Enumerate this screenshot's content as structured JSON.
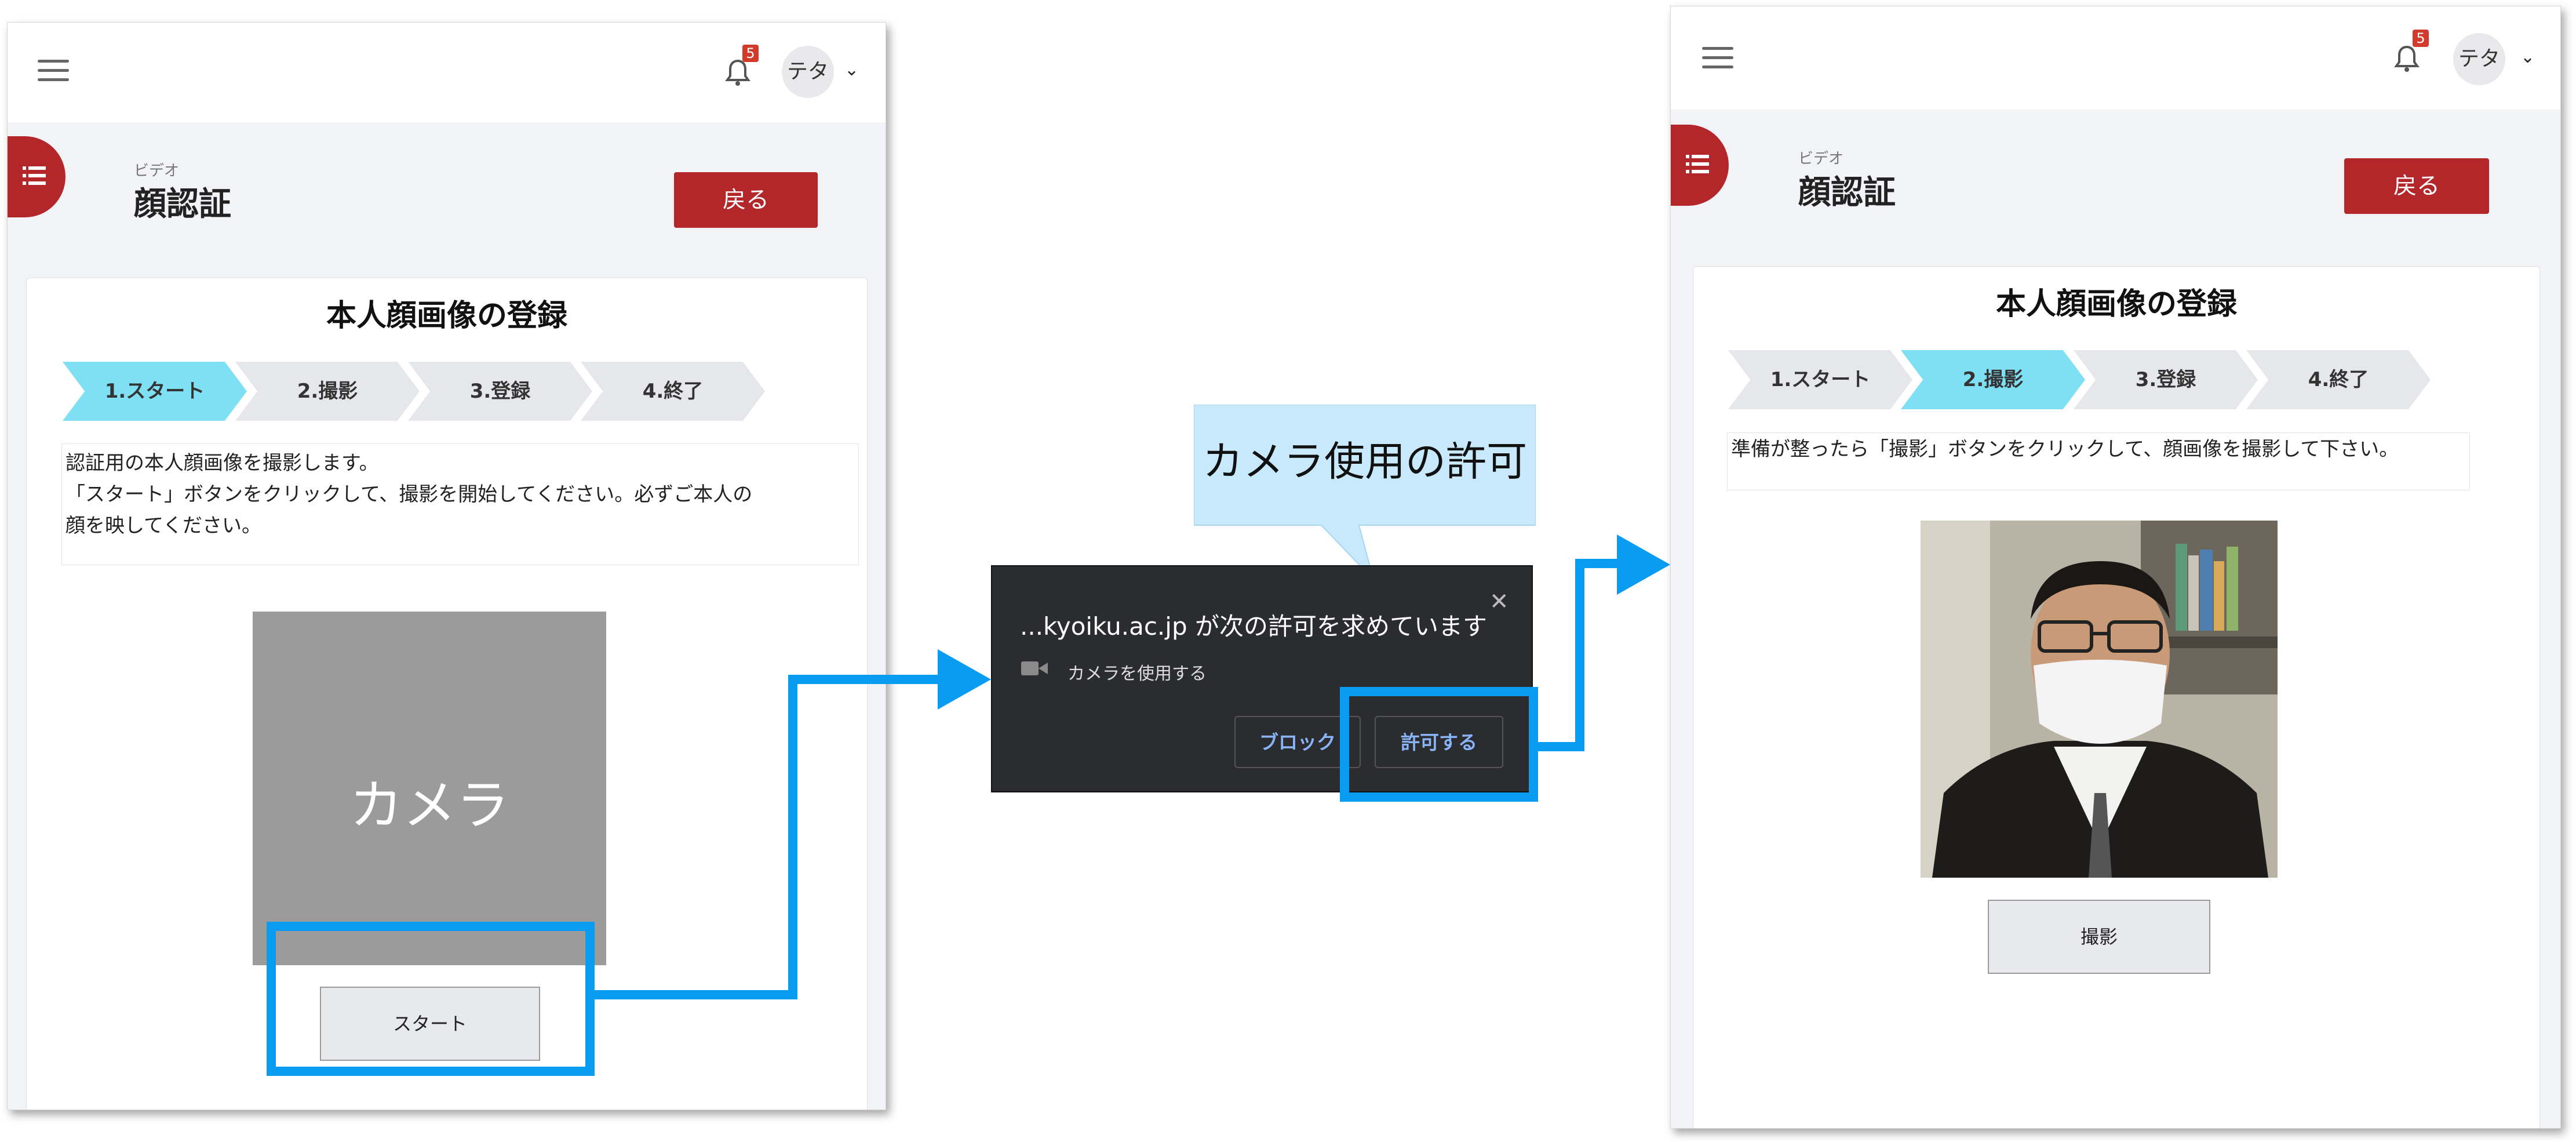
{
  "header": {
    "notification_count": "5",
    "user_initials": "テタ"
  },
  "page": {
    "kicker": "ビデオ",
    "title": "顔認証",
    "back_label": "戻る"
  },
  "card": {
    "title": "本人顔画像の登録"
  },
  "steps": [
    "1.スタート",
    "2.撮影",
    "3.登録",
    "4.終了"
  ],
  "screen1": {
    "active_step": 0,
    "description_lines": [
      "認証用の本人顔画像を撮影します。",
      "「スタート」ボタンをクリックして、撮影を開始してください。必ずご本人の",
      "顔を映してください。"
    ],
    "camera_placeholder": "カメラ",
    "start_button": "スタート"
  },
  "callout": {
    "text": "カメラ使用の許可"
  },
  "dialog": {
    "title": "...kyoiku.ac.jp が次の許可を求めています",
    "permission": "カメラを使用する",
    "block_button": "ブロック",
    "allow_button": "許可する",
    "close_glyph": "✕"
  },
  "screen2": {
    "active_step": 1,
    "description": "準備が整ったら「撮影」ボタンをクリックして、顔画像を撮影して下さい。",
    "capture_button": "撮影"
  },
  "colors": {
    "accent_red": "#b3262a",
    "step_active": "#7fe0f4",
    "arrow_blue": "#0a9cf0",
    "dialog_bg": "#2b2c2f"
  }
}
